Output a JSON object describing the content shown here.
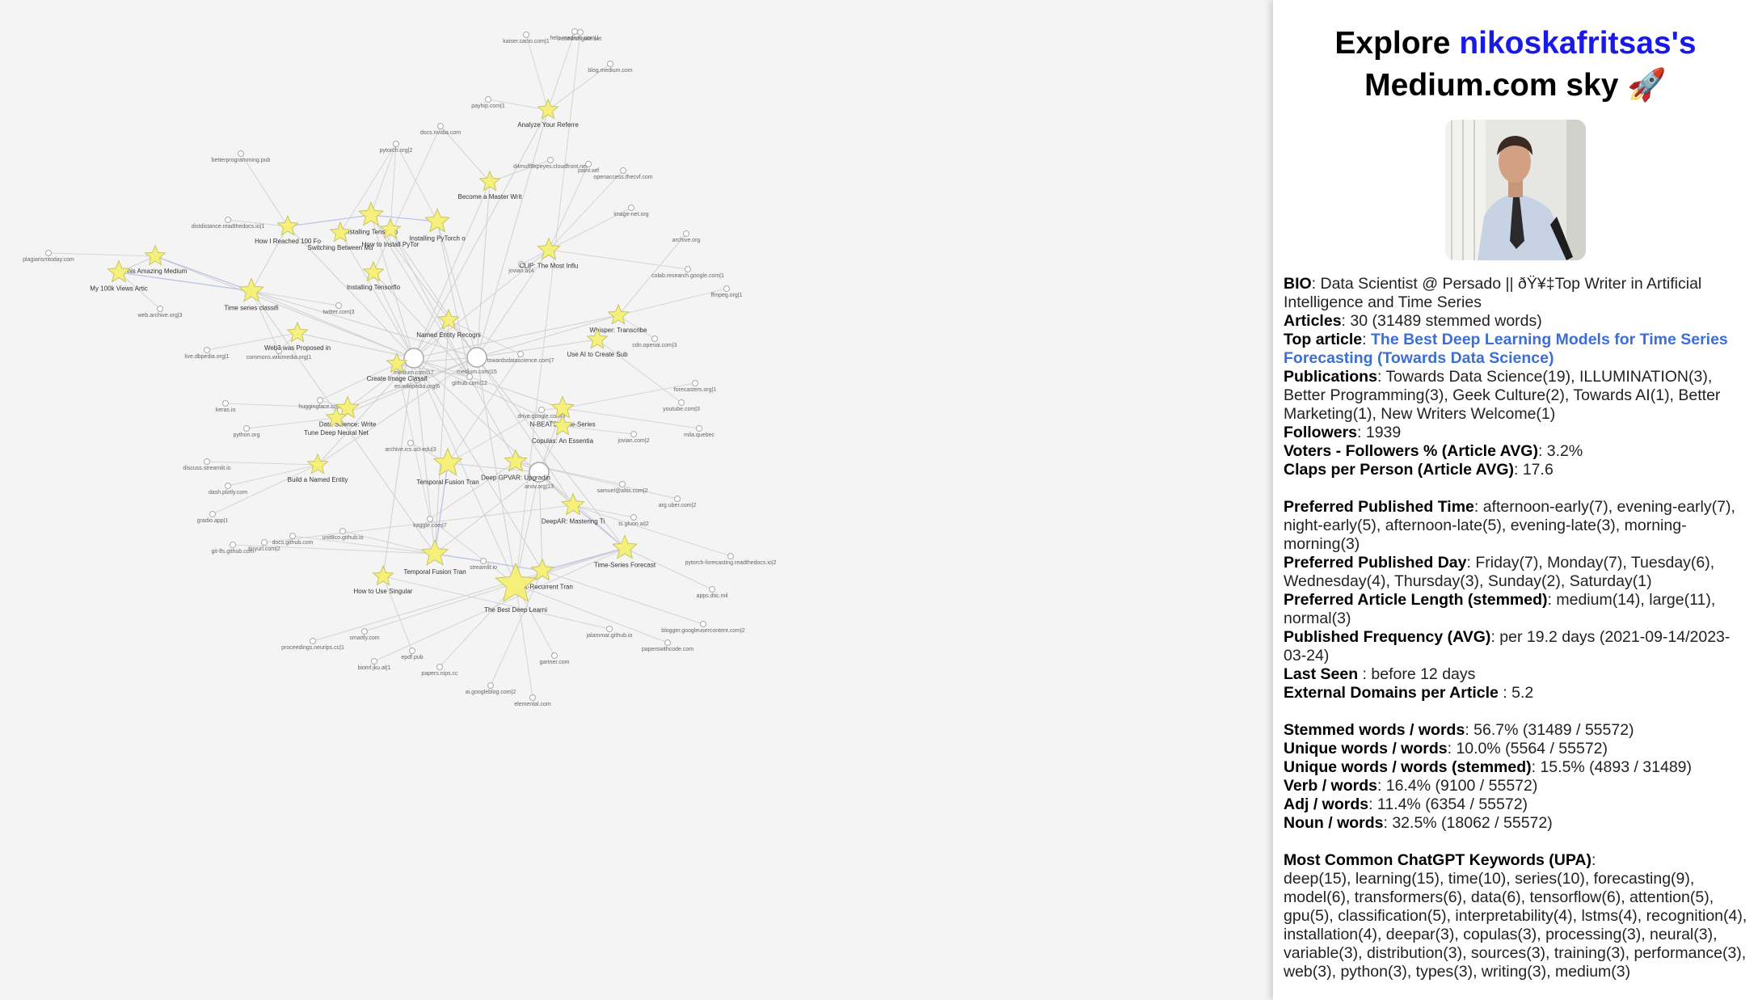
{
  "graph": {
    "articles": [
      {
        "label": "Analyze Your Referre",
        "s": 1
      },
      {
        "label": "Become a Master Writ",
        "s": 1
      },
      {
        "label": "Installing Tensorflo",
        "s": 1.2
      },
      {
        "label": "Switching Between Mu",
        "s": 1
      },
      {
        "label": "How to Install PyTor",
        "s": 1
      },
      {
        "label": "Installing PyTorch o",
        "s": 1.2
      },
      {
        "label": "How I Reached 100 Fo",
        "s": 1
      },
      {
        "label": "This Amazing Medium",
        "s": 1
      },
      {
        "label": "My 100k Views Artic",
        "s": 1.1
      },
      {
        "label": "Time series classifi",
        "s": 1.2
      },
      {
        "label": "Installing Tensorflo",
        "s": 1
      },
      {
        "label": "CLIP: The Most Influ",
        "s": 1.1
      },
      {
        "label": "Named Entity Recogni",
        "s": 1
      },
      {
        "label": "Web3 was Proposed in",
        "s": 1
      },
      {
        "label": "Whisper: Transcribe",
        "s": 1
      },
      {
        "label": "Use AI to Create Sub",
        "s": 1
      },
      {
        "label": "Create Image Classif",
        "s": 1
      },
      {
        "label": "Data Science: Write",
        "s": 1.1
      },
      {
        "label": "Tune Deep Neural Net",
        "s": 1
      },
      {
        "label": "N-BEATS: Time-Series",
        "s": 1.1
      },
      {
        "label": "Copulas: An Essentia",
        "s": 1
      },
      {
        "label": "Build a Named Entity",
        "s": 1
      },
      {
        "label": "Temporal Fusion Tran",
        "s": 1.4
      },
      {
        "label": "Deep GPVAR: Upgradin",
        "s": 1.1
      },
      {
        "label": "DeepAR: Mastering Ti",
        "s": 1.1
      },
      {
        "label": "Temporal Fusion Tran",
        "s": 1.3
      },
      {
        "label": "How to Use Singular",
        "s": 1
      },
      {
        "label": "Black-Recurrent Tran",
        "s": 1.1
      },
      {
        "label": "The Best Deep Learni",
        "s": 2
      },
      {
        "label": "Time-Series Forecast",
        "s": 1.2
      }
    ],
    "domains": [
      {
        "label": "kaiser.cacio.com|1",
        "big": false
      },
      {
        "label": "help.medium.com|1",
        "big": false
      },
      {
        "label": "blog.medium.com",
        "big": false
      },
      {
        "label": "payhip.com|1",
        "big": false
      },
      {
        "label": "docs.nvidia.com",
        "big": false
      },
      {
        "label": "pytorch.org|2",
        "big": false
      },
      {
        "label": "betterprogramming.pub",
        "big": false
      },
      {
        "label": "d4muff9kpeyes.cloudfront.net",
        "big": false
      },
      {
        "label": "paint.wtf",
        "big": false
      },
      {
        "label": "openaccess.thecvf.com",
        "big": false
      },
      {
        "label": "image-net.org",
        "big": false
      },
      {
        "label": "distdistance.readthedocs.io|1",
        "big": false
      },
      {
        "label": "plagiarismtoday.com",
        "big": false
      },
      {
        "label": "archive.org",
        "big": false
      },
      {
        "label": "colab.research.google.com|1",
        "big": false
      },
      {
        "label": "ffmpeg.org|1",
        "big": false
      },
      {
        "label": "jovian.ai|4",
        "big": false
      },
      {
        "label": "twitter.com|3",
        "big": false
      },
      {
        "label": "web.archive.org|3",
        "big": false
      },
      {
        "label": "cdn.openai.com|3",
        "big": false
      },
      {
        "label": "live.dbpedia.org|1",
        "big": false
      },
      {
        "label": "commons.wikimedia.org|1",
        "big": false
      },
      {
        "label": "medium.com|17",
        "big": true
      },
      {
        "label": "medium.com|15",
        "big": true
      },
      {
        "label": "towardsdatascience.com|7",
        "big": false
      },
      {
        "label": "en.wikipedia.org|6",
        "big": false
      },
      {
        "label": "github.com|12",
        "big": false
      },
      {
        "label": "forecasters.org|1",
        "big": false
      },
      {
        "label": "keras.io",
        "big": false
      },
      {
        "label": "huggingface.co|3",
        "big": false
      },
      {
        "label": "drive.google.com|3",
        "big": false
      },
      {
        "label": "youtube.com|3",
        "big": false
      },
      {
        "label": "mila.quebec",
        "big": false
      },
      {
        "label": "python.org",
        "big": false
      },
      {
        "label": "jovian.com|2",
        "big": false
      },
      {
        "label": "archive.ics.uci.edu|3",
        "big": false
      },
      {
        "label": "discuss.streamlit.io",
        "big": false
      },
      {
        "label": "arxiv.org|13",
        "big": true
      },
      {
        "label": "dash.plotly.com",
        "big": false
      },
      {
        "label": "samuel@altis.com|2",
        "big": false
      },
      {
        "label": "gradio.app|1",
        "big": false
      },
      {
        "label": "arg.uber.com|2",
        "big": false
      },
      {
        "label": "kaggle.com|7",
        "big": false
      },
      {
        "label": "unit8co.github.io",
        "big": false
      },
      {
        "label": "tinyurl.com|2",
        "big": false
      },
      {
        "label": "ts.gluon.ai|2",
        "big": false
      },
      {
        "label": "git-lfs.github.com",
        "big": false
      },
      {
        "label": "docs.github.com",
        "big": false
      },
      {
        "label": "streamlit.io",
        "big": false
      },
      {
        "label": "pytorch-forecasting.readthedocs.io|2",
        "big": false
      },
      {
        "label": "apps.dtic.mil",
        "big": false
      },
      {
        "label": "smartly.com",
        "big": false
      },
      {
        "label": "jalammar.github.io",
        "big": false
      },
      {
        "label": "blogger.googleusercontent.com|2",
        "big": false
      },
      {
        "label": "proceedings.neurips.cc|1",
        "big": false
      },
      {
        "label": "epdf.pub",
        "big": false
      },
      {
        "label": "paperswithcode.com",
        "big": false
      },
      {
        "label": "bioinf.jku.at|1",
        "big": false
      },
      {
        "label": "papers.nips.cc",
        "big": false
      },
      {
        "label": "gartner.com",
        "big": false
      },
      {
        "label": "ai.googleblog.com|2",
        "big": false
      },
      {
        "label": "elemental.com",
        "big": false
      },
      {
        "label": "researchgate.net",
        "big": false
      }
    ]
  },
  "panel": {
    "title_prefix": "Explore",
    "username": "nikoskafritsas's",
    "title_suffix": "Medium.com sky 🚀",
    "bio_label": "BIO",
    "bio": ": Data Scientist @ Persado || ðŸ¥‡Top Writer in Artificial Intelligence and Time Series",
    "articles_label": "Articles",
    "articles": ": 30 (31489 stemmed words)",
    "top_article_label": "Top article",
    "top_article": "The Best Deep Learning Models for Time Series Forecasting (Towards Data Science)",
    "publications_label": "Publications",
    "publications": ": Towards Data Science(19), ILLUMINATION(3), Better Programming(3), Geek Culture(2), Towards AI(1), Better Marketing(1), New Writers Welcome(1)",
    "followers_label": "Followers",
    "followers": ": 1939",
    "voters_label": "Voters - Followers % (Article AVG)",
    "voters": ": 3.2%",
    "claps_label": "Claps per Person (Article AVG)",
    "claps": ": 17.6",
    "pub_time_label": "Preferred Published Time",
    "pub_time": ": afternoon-early(7), evening-early(7), night-early(5), afternoon-late(5), evening-late(3), morning-morning(3)",
    "pub_day_label": "Preferred Published Day",
    "pub_day": ": Friday(7), Monday(7), Tuesday(6), Wednesday(4), Thursday(3), Sunday(2), Saturday(1)",
    "length_label": "Preferred Article Length (stemmed)",
    "length": ": medium(14), large(11), normal(3)",
    "frequency_label": "Published Frequency (AVG)",
    "frequency": ": per 19.2 days (2021-09-14/2023-03-24)",
    "last_seen_label": "Last Seen",
    "last_seen": " : before 12 days",
    "ext_domains_label": "External Domains per Article",
    "ext_domains": " : 5.2",
    "stemmed_label": "Stemmed words / words",
    "stemmed": ": 56.7% (31489 / 55572)",
    "unique_label": "Unique words / words",
    "unique": ": 10.0% (5564 / 55572)",
    "unique_stem_label": "Unique words / words (stemmed)",
    "unique_stem": ": 15.5% (4893 / 31489)",
    "verb_label": "Verb / words",
    "verb": ": 16.4% (9100 / 55572)",
    "adj_label": "Adj / words",
    "adj": ": 11.4% (6354 / 55572)",
    "noun_label": "Noun / words",
    "noun": ": 32.5% (18062 / 55572)",
    "keywords_label": "Most Common ChatGPT Keywords (UPA)",
    "keywords": "deep(15), learning(15), time(10), series(10), forecasting(9), model(6), transformers(6), data(6), tensorflow(6), attention(5), gpu(5), classification(5), interpretability(4), lstms(4), recognition(4), installation(4), deepar(3), copulas(3), processing(3), neural(3), variable(3), distribution(3), sources(3), training(3), performance(3), web(3), python(3), types(3), writing(3), medium(3)"
  }
}
